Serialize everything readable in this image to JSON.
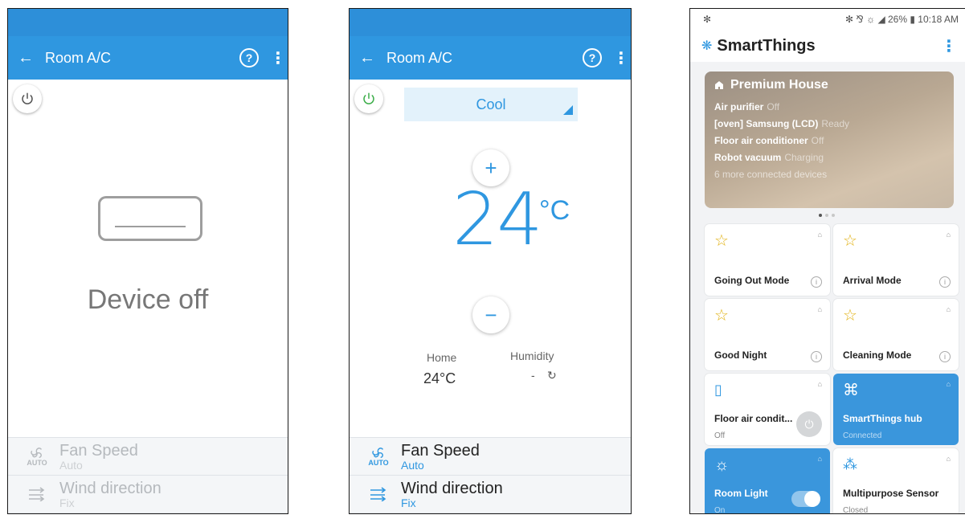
{
  "screen_off": {
    "title": "Room A/C",
    "help_icon": "?",
    "more_icon": "⋮",
    "back_icon": "←",
    "status": "Device off",
    "list": [
      {
        "label": "Fan Speed",
        "value": "Auto",
        "icon_caption": "AUTO"
      },
      {
        "label": "Wind direction",
        "value": "Fix"
      }
    ]
  },
  "screen_on": {
    "title": "Room A/C",
    "help_icon": "?",
    "more_icon": "⋮",
    "back_icon": "←",
    "mode": "Cool",
    "temperature": "24",
    "temperature_unit": "°C",
    "plus": "+",
    "minus": "−",
    "home_label": "Home",
    "home_value": "24°C",
    "humidity_label": "Humidity",
    "humidity_value": "-",
    "list": [
      {
        "label": "Fan Speed",
        "value": "Auto",
        "icon_caption": "AUTO"
      },
      {
        "label": "Wind direction",
        "value": "Fix"
      }
    ]
  },
  "smartthings": {
    "status_bar": {
      "left_icon": "✻",
      "right": "✻ ⅋ ☼ ◢ 26% ▮ 10:18 AM"
    },
    "brand": "SmartThings",
    "location": {
      "name": "Premium House",
      "devices": [
        {
          "name": "Air purifier",
          "state": "Off"
        },
        {
          "name": "[oven] Samsung (LCD)",
          "state": "Ready"
        },
        {
          "name": "Floor air conditioner",
          "state": "Off"
        },
        {
          "name": "Robot vacuum",
          "state": "Charging"
        }
      ],
      "more": "6 more connected devices"
    },
    "tiles": [
      {
        "name": "Going Out Mode",
        "type": "scene"
      },
      {
        "name": "Arrival Mode",
        "type": "scene"
      },
      {
        "name": "Good Night",
        "type": "scene"
      },
      {
        "name": "Cleaning Mode",
        "type": "scene"
      },
      {
        "name": "Floor air condit...",
        "status": "Off",
        "type": "device"
      },
      {
        "name": "SmartThings hub",
        "status": "Connected",
        "type": "device"
      },
      {
        "name": "Room Light",
        "status": "On",
        "type": "device"
      },
      {
        "name": "Multipurpose Sensor",
        "status": "Closed",
        "type": "device"
      }
    ]
  },
  "colors": {
    "accent": "#2f97e0",
    "statusbar": "#2d8fd9",
    "scene_star": "#e2b318"
  }
}
